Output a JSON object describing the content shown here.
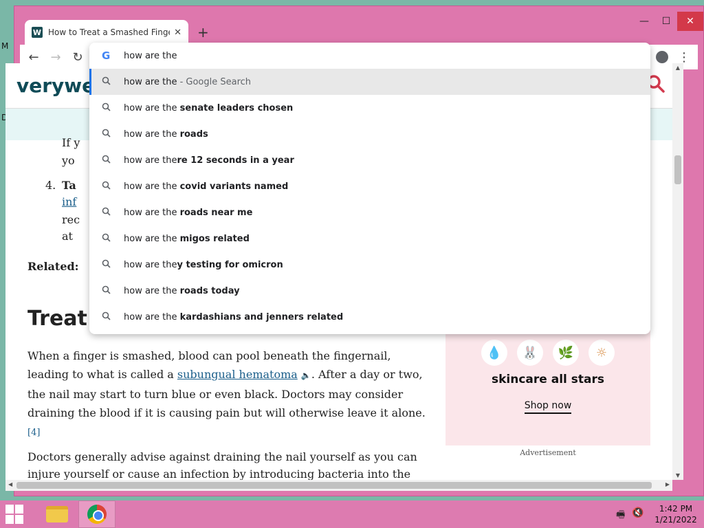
{
  "desktop": {
    "letter_m": "M",
    "letter_d": "D"
  },
  "window": {
    "minimize": "—",
    "maximize": "☐",
    "close": "✕"
  },
  "tab": {
    "favicon": "W",
    "title": "How to Treat a Smashed Finger",
    "close": "✕",
    "new_tab": "+"
  },
  "toolbar": {
    "back": "←",
    "forward": "→",
    "reload": "↻",
    "menu": "⋮"
  },
  "page": {
    "logo": "verywe",
    "article": {
      "list_start_1": "If y",
      "list_start_2": "yo",
      "item4_num": "4.",
      "item4_bold": "Ta",
      "item4_link": "inf",
      "item4_line2": "rec",
      "item4_line3": "at",
      "related": "Related:",
      "heading": "Treat",
      "para1_a": "When a finger is smashed, blood can pool beneath the fingernail, leading to what is called a ",
      "para1_link": "subungual hematoma",
      "para1_b": ". After a day or two, the nail may start to turn blue or even black. Doctors may consider draining the blood if it is causing pain but will otherwise leave it alone.",
      "para1_ref": "[4]",
      "para2": "Doctors generally advise against draining the nail yourself as you can injure yourself or cause an infection by introducing bacteria into the"
    },
    "ad": {
      "title": "skincare all stars",
      "button": "Shop now",
      "label": "Advertisement"
    }
  },
  "omnibox": {
    "g_icon": "G",
    "input_value": "how are the",
    "suggestions": [
      {
        "prefix": "how are the",
        "rest": " - Google Search",
        "style": "muted"
      },
      {
        "prefix": "how are the ",
        "rest": "senate leaders chosen",
        "style": "bold"
      },
      {
        "prefix": "how are the ",
        "rest": "roads",
        "style": "bold"
      },
      {
        "prefix": "how are the",
        "rest": "re 12 seconds in a year",
        "style": "bold"
      },
      {
        "prefix": "how are the ",
        "rest": "covid variants named",
        "style": "bold"
      },
      {
        "prefix": "how are the ",
        "rest": "roads near me",
        "style": "bold"
      },
      {
        "prefix": "how are the ",
        "rest": "migos related",
        "style": "bold"
      },
      {
        "prefix": "how are the",
        "rest": "y testing for omicron",
        "style": "bold"
      },
      {
        "prefix": "how are the ",
        "rest": "roads today",
        "style": "bold"
      },
      {
        "prefix": "how are the ",
        "rest": "kardashians and jenners related",
        "style": "bold"
      }
    ]
  },
  "taskbar": {
    "time": "1:42 PM",
    "date": "1/21/2022"
  }
}
